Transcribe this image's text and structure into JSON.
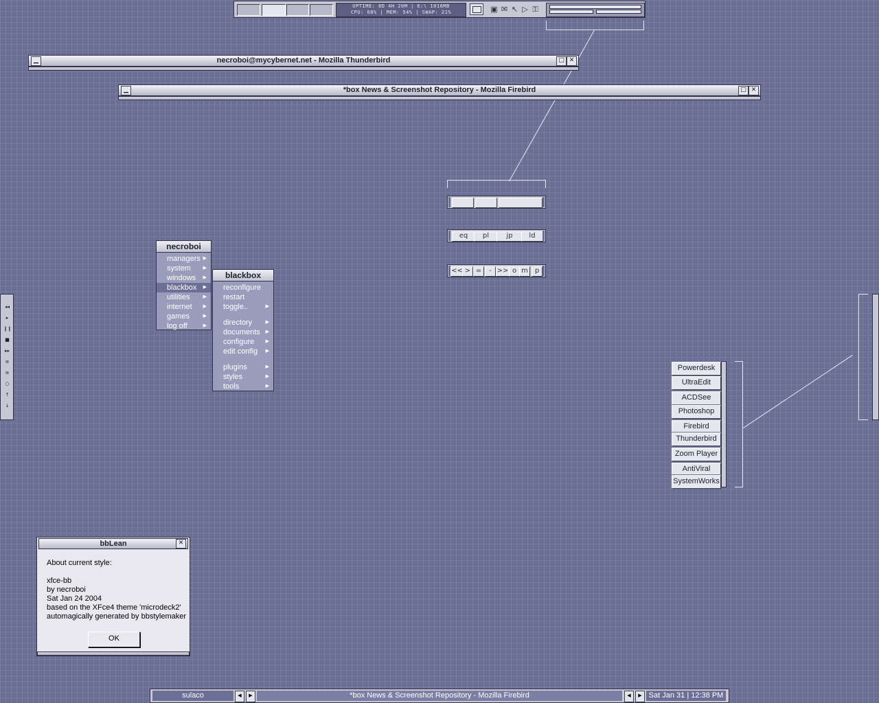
{
  "top_toolbar": {
    "workspaces": [
      "",
      "",
      "",
      ""
    ],
    "stats_line1": "UPTIME: 8D 4H 20M  |  E:\\ 1016MB",
    "stats_line2": "CPU: 08%  |  MEM: 54%  |  SWAP: 21%"
  },
  "windows": {
    "thunderbird_title": "necroboi@mycybernet.net - Mozilla Thunderbird",
    "firebird_title": "*box News & Screenshot Repository - Mozilla Firebird"
  },
  "plugin_bars": {
    "eq_bar": [
      "eq",
      "pl",
      "jp",
      "ld"
    ],
    "transport_bar": [
      "<<",
      ">",
      "=",
      "-",
      ">>",
      "o",
      "m",
      "p"
    ]
  },
  "root_menu": {
    "title": "necroboi",
    "items": [
      "managers",
      "system",
      "windows",
      "blackbox",
      "utilities",
      "internet",
      "games",
      "log off"
    ]
  },
  "blackbox_menu": {
    "title": "blackbox",
    "group1": [
      "reconfigure",
      "restart",
      "toggle.."
    ],
    "group2": [
      "directory",
      "documents",
      "configure",
      "edit config"
    ],
    "group3": [
      "plugins",
      "styles",
      "tools"
    ]
  },
  "media_bar": {
    "buttons": [
      "◂◂",
      "▸",
      "❙❙",
      "■",
      "▸▸",
      "≡",
      "≡",
      "○",
      "↑",
      "↓"
    ]
  },
  "launch_bar": {
    "items": [
      "Powerdesk",
      "UltraEdit",
      "ACDSee",
      "Photoshop",
      "Firebird",
      "Thunderbird",
      "Zoom Player",
      "AntiViral",
      "SystemWorks"
    ]
  },
  "dialog": {
    "title": "bbLean",
    "line1": "About current style:",
    "line2": "xfce-bb",
    "line3": "by necroboi",
    "line4": "Sat Jan 24 2004",
    "line5": "based on the XFce4 theme 'microdeck2'",
    "line6": "automagically generated by bbstylemaker",
    "ok": "OK"
  },
  "taskbar": {
    "workspace": "sulaco",
    "task": "*box News & Screenshot Repository - Mozilla Firebird",
    "clock": "Sat Jan 31 | 12:38 PM"
  }
}
